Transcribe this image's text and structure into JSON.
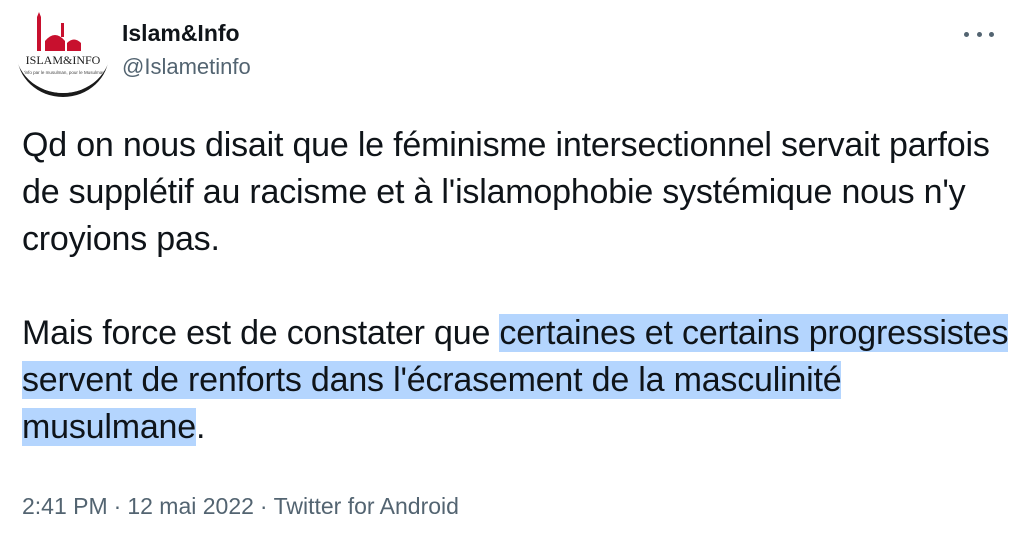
{
  "account": {
    "display_name": "Islam&Info",
    "handle": "@Islametinfo",
    "avatar_logo_text": "ISLAM&INFO",
    "avatar_tagline": "L'info par le musulman, pour le Musulman"
  },
  "more_icon": "more-horizontal-icon",
  "tweet": {
    "paragraph1": "Qd on nous disait que le féminisme intersectionnel servait parfois de supplétif au racisme et à l'islamophobie systémique nous n'y croyions pas.",
    "paragraph2_plain": "Mais force est de constater que ",
    "paragraph2_highlighted": "certaines et certains progressistes servent de renforts dans l'écrasement de la masculinité musulmane",
    "paragraph2_end": "."
  },
  "meta": {
    "time": "2:41 PM",
    "separator": "·",
    "date": "12 mai 2022",
    "source": "Twitter for Android"
  },
  "colors": {
    "text": "#0f1419",
    "secondary": "#536471",
    "selection": "#b4d5fe",
    "logo_red": "#c8102e"
  }
}
